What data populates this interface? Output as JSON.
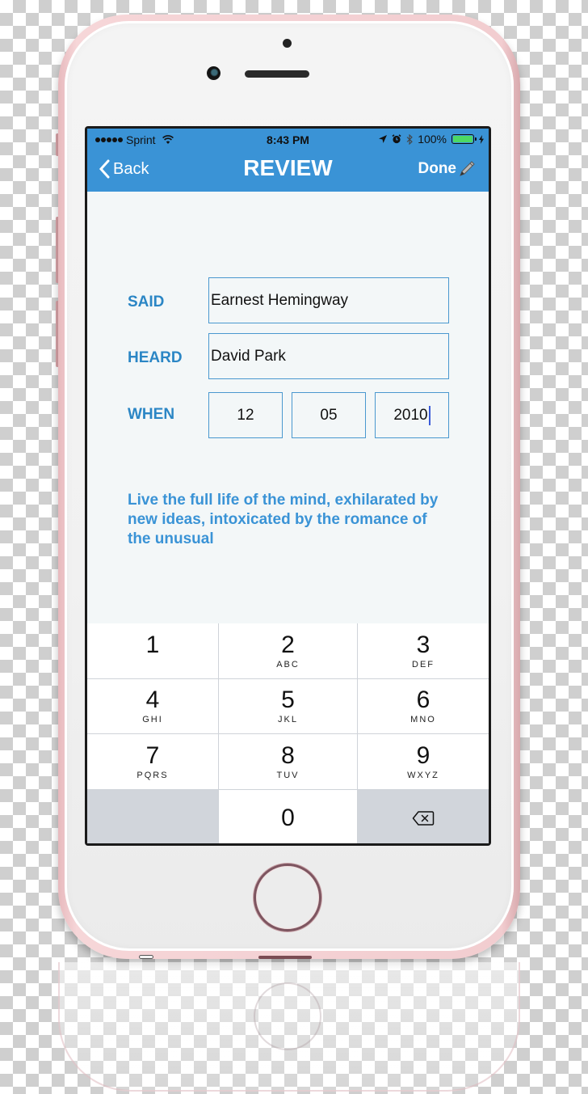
{
  "device": {
    "model": "iPhone",
    "color": "rose-gold",
    "frame_color": "#f2cdd0",
    "home_button_icon": "home-button"
  },
  "status_bar": {
    "signal_dots": 5,
    "carrier": "Sprint",
    "wifi_icon": "wifi-icon",
    "time": "8:43 PM",
    "location_icon": "location-arrow-icon",
    "alarm_icon": "alarm-clock-icon",
    "bluetooth_icon": "bluetooth-icon",
    "battery_percent_text": "100%",
    "battery_level": 1.0,
    "charging_icon": "lightning-bolt-icon"
  },
  "navbar": {
    "back_label": "Back",
    "title": "REVIEW",
    "done_label": "Done",
    "done_icon": "pen-icon",
    "color": "#3a93d6"
  },
  "form": {
    "said": {
      "label": "SAID",
      "value": "Earnest Hemingway"
    },
    "heard": {
      "label": "HEARD",
      "value": "David Park"
    },
    "when": {
      "label": "WHEN",
      "month": "12",
      "day": "05",
      "year": "2010",
      "focused_field": "year"
    },
    "label_color": "#2b86c5"
  },
  "quote": {
    "text": "Live the full life of the mind, exhilarated by new ideas, intoxicated by the romance of the unusual",
    "color": "#3a93d6"
  },
  "keypad": {
    "keys": [
      {
        "num": "1",
        "letters": ""
      },
      {
        "num": "2",
        "letters": "ABC"
      },
      {
        "num": "3",
        "letters": "DEF"
      },
      {
        "num": "4",
        "letters": "GHI"
      },
      {
        "num": "5",
        "letters": "JKL"
      },
      {
        "num": "6",
        "letters": "MNO"
      },
      {
        "num": "7",
        "letters": "PQRS"
      },
      {
        "num": "8",
        "letters": "TUV"
      },
      {
        "num": "9",
        "letters": "WXYZ"
      },
      {
        "num": "",
        "letters": ""
      },
      {
        "num": "0",
        "letters": ""
      },
      {
        "num": "",
        "letters": "",
        "icon": "backspace-icon"
      }
    ]
  }
}
